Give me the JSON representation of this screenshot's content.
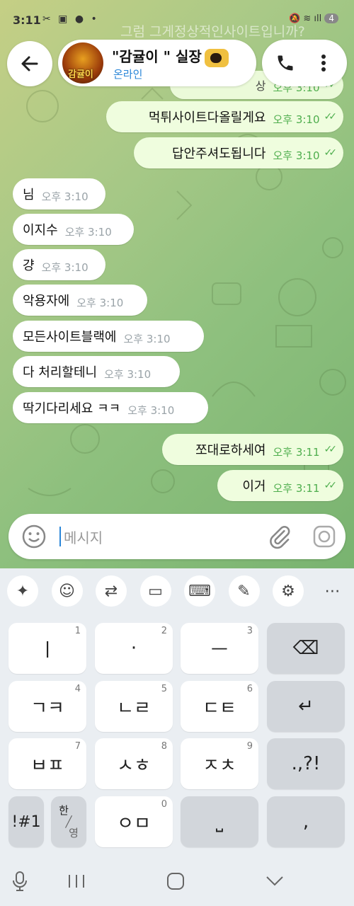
{
  "status_bar": {
    "time": "3:11",
    "left_icons": "✂ ▣ ● •",
    "right_icons": "🔕 ≋ ıll",
    "battery": "4"
  },
  "header": {
    "title": "\"감귤이 \" 실장",
    "status": "온라인",
    "avatar_text": "감귤이"
  },
  "background_texts": {
    "top_ghost": "그럼 그게정상적인사이트입니까?",
    "partial_line": "상"
  },
  "messages": [
    {
      "dir": "out",
      "text": "먹튀사이트다올릴게요",
      "time": "오후 3:10",
      "read": true
    },
    {
      "dir": "out",
      "text": "답안주셔도됩니다",
      "time": "오후 3:10",
      "read": true
    },
    {
      "dir": "in",
      "text": "님",
      "time": "오후 3:10"
    },
    {
      "dir": "in",
      "text": "이지수",
      "time": "오후 3:10"
    },
    {
      "dir": "in",
      "text": "걍",
      "time": "오후 3:10"
    },
    {
      "dir": "in",
      "text": "악용자에",
      "time": "오후 3:10"
    },
    {
      "dir": "in",
      "text": "모든사이트블랙에",
      "time": "오후 3:10"
    },
    {
      "dir": "in",
      "text": "다 처리할테니",
      "time": "오후 3:10"
    },
    {
      "dir": "in",
      "text": "딱기다리세요 ㅋㅋ",
      "time": "오후 3:10"
    },
    {
      "dir": "out",
      "text": "쪼대로하세여",
      "time": "오후 3:11",
      "read": true
    },
    {
      "dir": "out",
      "text": "이거",
      "time": "오후 3:11",
      "read": true
    }
  ],
  "partial_top_message": {
    "time": "오후 3:10"
  },
  "input": {
    "placeholder": "메시지"
  },
  "toolbar": [
    "ai-sparkle-icon",
    "emoji-icon",
    "translate-icon",
    "clipboard-icon",
    "keyboard-icon",
    "handwriting-icon",
    "settings-icon",
    "more-icon"
  ],
  "keyboard": {
    "rows": [
      [
        {
          "label": "ㅣ",
          "num": "1"
        },
        {
          "label": "·",
          "num": "2"
        },
        {
          "label": "ㅡ",
          "num": "3"
        },
        {
          "label": "⌫",
          "num": "",
          "gray": true
        }
      ],
      [
        {
          "label": "ㄱㅋ",
          "num": "4"
        },
        {
          "label": "ㄴㄹ",
          "num": "5"
        },
        {
          "label": "ㄷㅌ",
          "num": "6"
        },
        {
          "label": "↵",
          "num": "",
          "gray": true
        }
      ],
      [
        {
          "label": "ㅂㅍ",
          "num": "7"
        },
        {
          "label": "ㅅㅎ",
          "num": "8"
        },
        {
          "label": "ㅈㅊ",
          "num": "9"
        },
        {
          "label": ".,?!",
          "num": "",
          "gray": true
        }
      ]
    ],
    "bottom": {
      "sym": "!#1",
      "lang_top": "한",
      "lang_bottom": "영",
      "key0": "ㅇㅁ",
      "key0_num": "0",
      "space": "⎵",
      "comma": ","
    }
  },
  "nav": {
    "mic": "mic-icon",
    "recent": "|||",
    "home": "home",
    "back": "back"
  }
}
